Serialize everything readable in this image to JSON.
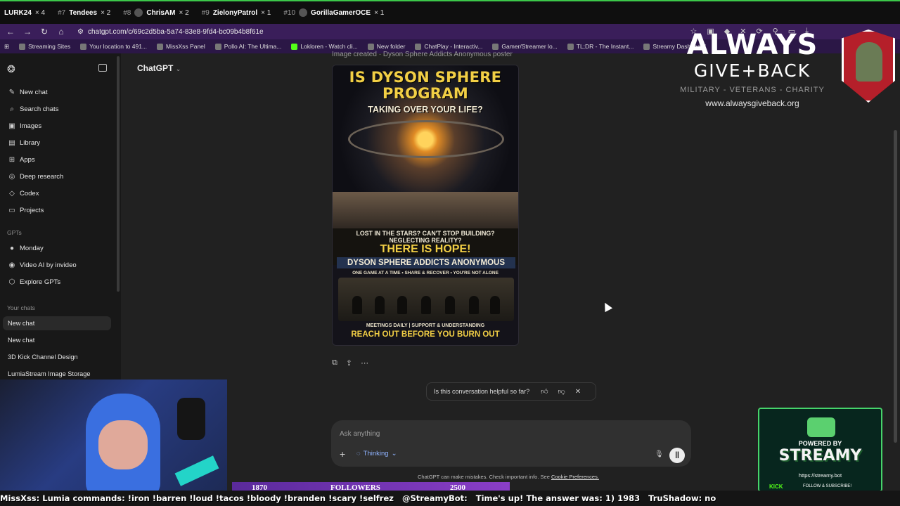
{
  "leaderboard": [
    {
      "rank": "",
      "name": "LURK24",
      "mult": "× 4"
    },
    {
      "rank": "#7",
      "name": "Tendees",
      "mult": "× 2"
    },
    {
      "rank": "#8",
      "name": "ChrisAM",
      "mult": "× 2"
    },
    {
      "rank": "#9",
      "name": "ZielonyPatrol",
      "mult": "× 1"
    },
    {
      "rank": "#10",
      "name": "GorillaGamerOCE",
      "mult": "× 1"
    }
  ],
  "browser": {
    "url": "chatgpt.com/c/69c2d5ba-5a74-83e8-9fd4-bc09b4b8f61e",
    "bookmarks": [
      "Streaming Sites",
      "Your location to 491...",
      "MissXss Panel",
      "Pollo AI: The Ultima...",
      "Lokloren - Watch cli...",
      "New folder",
      "ChatPlay - Interactiv...",
      "Gamer/Streamer lo...",
      "TL;DR - The Instant...",
      "Streamy Dashboard"
    ]
  },
  "sidebar": {
    "nav": [
      {
        "icon": "✎",
        "label": "New chat"
      },
      {
        "icon": "⌕",
        "label": "Search chats"
      },
      {
        "icon": "▣",
        "label": "Images"
      },
      {
        "icon": "▤",
        "label": "Library"
      },
      {
        "icon": "⊞",
        "label": "Apps"
      },
      {
        "icon": "◎",
        "label": "Deep research"
      },
      {
        "icon": "◇",
        "label": "Codex"
      },
      {
        "icon": "▭",
        "label": "Projects"
      }
    ],
    "gpts_label": "GPTs",
    "gpts": [
      {
        "icon": "●",
        "label": "Monday"
      },
      {
        "icon": "◉",
        "label": "Video AI by invideo"
      },
      {
        "icon": "⬡",
        "label": "Explore GPTs"
      }
    ],
    "chats_label": "Your chats",
    "chats": [
      "New chat",
      "New chat",
      "3D Kick Channel Design",
      "LumiaStream Image Storage"
    ]
  },
  "main": {
    "model_label": "ChatGPT",
    "image_caption": "Image created · Dyson Sphere Addicts Anonymous poster",
    "poster": {
      "headline": "IS DYSON SPHERE PROGRAM",
      "subhead": "TAKING OVER YOUR LIFE?",
      "lost": "LOST IN THE STARS? CAN'T STOP BUILDING?",
      "neglect": "NEGLECTING REALITY?",
      "hope": "THERE IS HOPE!",
      "group": "DYSON SPHERE ADDICTS ANONYMOUS",
      "tags": "ONE GAME AT A TIME  •  SHARE & RECOVER  •  YOU'RE NOT ALONE",
      "meetings": "MEETINGS DAILY  |  SUPPORT & UNDERSTANDING",
      "reach": "REACH OUT BEFORE YOU BURN OUT"
    },
    "feedback_question": "Is this conversation helpful so far?",
    "composer": {
      "placeholder": "Ask anything",
      "mode": "Thinking"
    },
    "disclaimer": "ChatGPT can make mistakes. Check important info. See",
    "disclaimer_link": "Cookie Preferences."
  },
  "overlay": {
    "charity": {
      "line1": "ALWAYS",
      "line2": "GIVE+BACK",
      "tagline": "MILITARY - VETERANS - CHARITY",
      "website": "www.alwaysgiveback.org"
    },
    "streamy": {
      "powered": "POWERED BY",
      "brand": "STREAMY",
      "site": "https://streamy.bot",
      "kick": "KICK",
      "follow": "FOLLOW & SUBSCRIBE!"
    },
    "goal": {
      "current": "1870",
      "label": "FOLLOWERS",
      "target": "2500"
    },
    "ticker": [
      "MissXss: Lumia commands: !iron !barren !loud !tacos !bloody !branden !scary !selfrez",
      "@StreamyBot:",
      "Time's up! The answer was: 1) 1983",
      "TruShadow: no"
    ]
  }
}
